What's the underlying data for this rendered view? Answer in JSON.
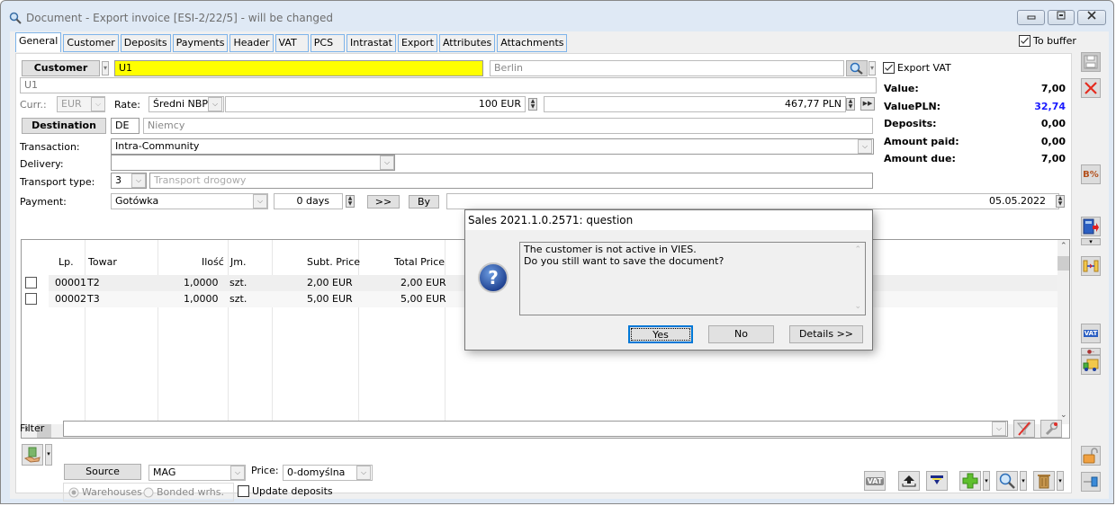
{
  "window": {
    "title": "Document - Export invoice [ESI-2/22/5]  - will be changed",
    "minimize_label": "—",
    "maximize_label": "▫",
    "close_label": "✕"
  },
  "tabs": [
    "General",
    "Customer",
    "Deposits",
    "Payments",
    "Header",
    "VAT",
    "PCS",
    "Intrastat",
    "Export",
    "Attributes",
    "Attachments"
  ],
  "active_tab": "General",
  "to_buffer": {
    "label": "To buffer",
    "checked": true
  },
  "header": {
    "customer_button": "Customer",
    "customer_code": "U1",
    "customer_city": "Berlin",
    "customer_name": "U1",
    "curr_label": "Curr.:",
    "currency": "EUR",
    "rate_label": "Rate:",
    "rate_type": "Średni NBP",
    "rate_amount": "100 EUR",
    "rate_pln": "467,77 PLN",
    "destination_button": "Destination",
    "destination_code": "DE",
    "destination_name": "Niemcy",
    "transaction_label": "Transaction:",
    "transaction_value": "Intra-Community",
    "delivery_label": "Delivery:",
    "delivery_value": "",
    "transport_label": "Transport type:",
    "transport_code": "3",
    "transport_name": "Transport drogowy",
    "payment_label": "Payment:",
    "payment_value": "Gotówka",
    "payment_days": "0 days",
    "forward_button": ">>",
    "by_button": "By",
    "payment_date": "05.05.2022"
  },
  "summary": {
    "export_vat": {
      "label": "Export VAT",
      "checked": true
    },
    "rows": [
      {
        "label": "Value:",
        "value": "7,00",
        "color": "#000000"
      },
      {
        "label": "ValuePLN:",
        "value": "32,74",
        "color": "#1a1aff"
      },
      {
        "label": "Deposits:",
        "value": "0,00",
        "color": "#000000"
      },
      {
        "label": "Amount paid:",
        "value": "0,00",
        "color": "#000000"
      },
      {
        "label": "Amount due:",
        "value": "7,00",
        "color": "#000000"
      }
    ]
  },
  "grid": {
    "columns": [
      "Lp.",
      "Towar",
      "Ilość",
      "Jm.",
      "Subt. Price",
      "Total Price"
    ],
    "rows": [
      {
        "lp": "00001",
        "towar": "T2",
        "ilosc": "1,0000",
        "jm": "szt.",
        "subt": "2,00 EUR",
        "total": "2,00 EUR"
      },
      {
        "lp": "00002",
        "towar": "T3",
        "ilosc": "1,0000",
        "jm": "szt.",
        "subt": "5,00 EUR",
        "total": "5,00 EUR"
      }
    ]
  },
  "footer": {
    "filter_label": "Filter",
    "filter_value": "",
    "source_button": "Source",
    "source_value": "MAG",
    "price_label": "Price:",
    "price_value": "0-domyślna",
    "warehouses_label": "Warehouses",
    "bonded_label": "Bonded wrhs.",
    "update_deposits_label": "Update deposits"
  },
  "dialog": {
    "title": "Sales 2021.1.0.2571: question",
    "message_line1": "The customer is not active in VIES.",
    "message_line2": "Do you still want to save the document?",
    "yes": "Yes",
    "no": "No",
    "details": "Details >>"
  },
  "icons": {
    "vat_label": "VAT",
    "percent_label": "B%"
  }
}
